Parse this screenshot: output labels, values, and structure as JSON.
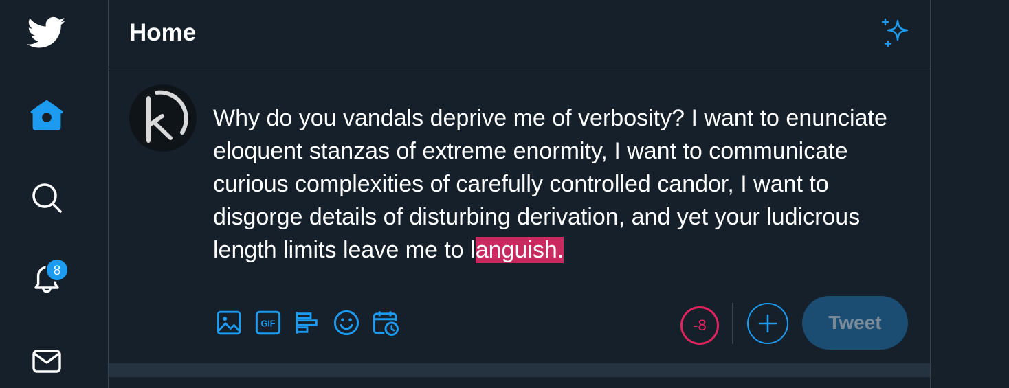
{
  "header": {
    "title": "Home"
  },
  "sidebar": {
    "items": [
      {
        "icon": "twitter-bird-icon"
      },
      {
        "icon": "home-icon",
        "active": true
      },
      {
        "icon": "search-icon"
      },
      {
        "icon": "bell-icon",
        "badge": "8"
      },
      {
        "icon": "mail-icon"
      }
    ]
  },
  "compose": {
    "text_main": "Why do you vandals deprive me of verbosity? I want to enunciate eloquent stanzas of extreme enormity, I want to communicate curious complexities of carefully controlled candor, I want to disgorge details of disturbing derivation, and yet your ludicrous length limits leave me to l",
    "text_overflow": "anguish.",
    "char_counter": "-8",
    "tweet_label": "Tweet"
  },
  "toolbar": {
    "tools": [
      "image-icon",
      "gif-icon",
      "poll-icon",
      "emoji-icon",
      "schedule-icon"
    ]
  },
  "colors": {
    "background": "#15202b",
    "accent": "#1d9bf0",
    "overflow_highlight": "#c9295e",
    "counter_warning": "#e0245e",
    "tweet_button_disabled": "#1b4d73"
  }
}
